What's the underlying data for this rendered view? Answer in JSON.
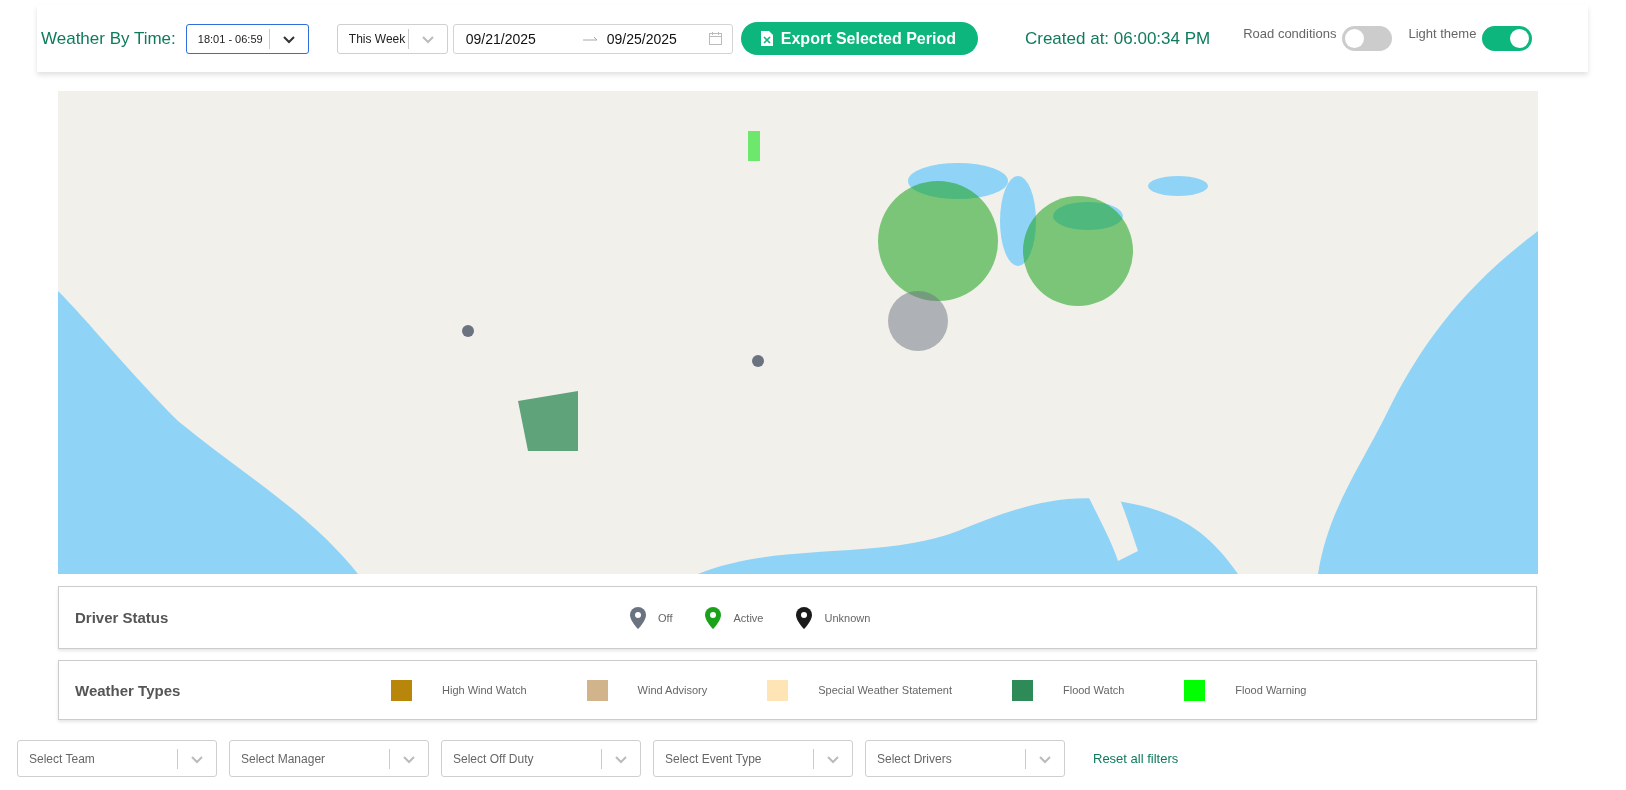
{
  "header": {
    "title": "Weather By Time:",
    "time_range": {
      "value": "18:01 - 06:59"
    },
    "period": {
      "value": "This Week"
    },
    "date_range": {
      "start": "09/21/2025",
      "end": "09/25/2025"
    },
    "export_button": "Export Selected Period",
    "created": "Created at: 06:00:34 PM",
    "toggles": [
      {
        "label": "Road conditions",
        "on": false
      },
      {
        "label": "Light theme",
        "on": true
      }
    ]
  },
  "driver_status": {
    "title": "Driver Status",
    "items": [
      {
        "label": "Off",
        "color": "#6b7280"
      },
      {
        "label": "Active",
        "color": "#1aa31a"
      },
      {
        "label": "Unknown",
        "color": "#1a1a1a"
      }
    ]
  },
  "weather_types": {
    "title": "Weather Types",
    "items": [
      {
        "label": "High Wind Watch",
        "color": "#b8860b"
      },
      {
        "label": "Wind Advisory",
        "color": "#d2b48c"
      },
      {
        "label": "Special Weather Statement",
        "color": "#ffe4b5"
      },
      {
        "label": "Flood Watch",
        "color": "#2e8b57"
      },
      {
        "label": "Flood Warning",
        "color": "#00ff00"
      }
    ]
  },
  "filters": [
    {
      "placeholder": "Select Team"
    },
    {
      "placeholder": "Select Manager"
    },
    {
      "placeholder": "Select Off Duty"
    },
    {
      "placeholder": "Select Event Type"
    },
    {
      "placeholder": "Select Drivers"
    }
  ],
  "reset_link": "Reset all filters"
}
